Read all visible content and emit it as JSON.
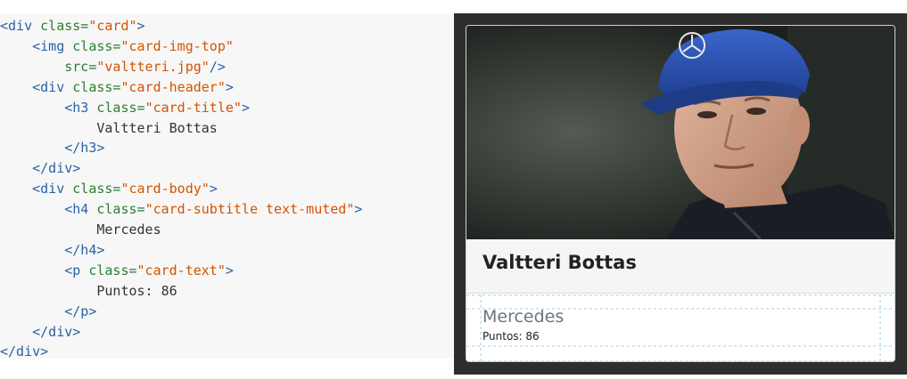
{
  "code": {
    "lines": [
      {
        "parts": [
          {
            "t": "tag",
            "v": "<div "
          },
          {
            "t": "attr",
            "v": "class="
          },
          {
            "t": "val",
            "v": "\"card\""
          },
          {
            "t": "tag",
            "v": ">"
          }
        ]
      },
      {
        "parts": [
          {
            "t": "text",
            "v": "    "
          },
          {
            "t": "tag",
            "v": "<img "
          },
          {
            "t": "attr",
            "v": "class="
          },
          {
            "t": "val",
            "v": "\"card-img-top\""
          }
        ]
      },
      {
        "parts": [
          {
            "t": "text",
            "v": "        "
          },
          {
            "t": "attr",
            "v": "src="
          },
          {
            "t": "val",
            "v": "\"valtteri.jpg\""
          },
          {
            "t": "tag",
            "v": "/>"
          }
        ]
      },
      {
        "parts": [
          {
            "t": "text",
            "v": "    "
          },
          {
            "t": "tag",
            "v": "<div "
          },
          {
            "t": "attr",
            "v": "class="
          },
          {
            "t": "val",
            "v": "\"card-header\""
          },
          {
            "t": "tag",
            "v": ">"
          }
        ]
      },
      {
        "parts": [
          {
            "t": "text",
            "v": "        "
          },
          {
            "t": "tag",
            "v": "<h3 "
          },
          {
            "t": "attr",
            "v": "class="
          },
          {
            "t": "val",
            "v": "\"card-title\""
          },
          {
            "t": "tag",
            "v": ">"
          }
        ]
      },
      {
        "parts": [
          {
            "t": "text",
            "v": "            Valtteri Bottas"
          }
        ]
      },
      {
        "parts": [
          {
            "t": "text",
            "v": "        "
          },
          {
            "t": "tag",
            "v": "</h3>"
          }
        ]
      },
      {
        "parts": [
          {
            "t": "text",
            "v": "    "
          },
          {
            "t": "tag",
            "v": "</div>"
          }
        ]
      },
      {
        "parts": [
          {
            "t": "text",
            "v": "    "
          },
          {
            "t": "tag",
            "v": "<div "
          },
          {
            "t": "attr",
            "v": "class="
          },
          {
            "t": "val",
            "v": "\"card-body\""
          },
          {
            "t": "tag",
            "v": ">"
          }
        ]
      },
      {
        "parts": [
          {
            "t": "text",
            "v": "        "
          },
          {
            "t": "tag",
            "v": "<h4 "
          },
          {
            "t": "attr",
            "v": "class="
          },
          {
            "t": "val",
            "v": "\"card-subtitle text-muted\""
          },
          {
            "t": "tag",
            "v": ">"
          }
        ]
      },
      {
        "parts": [
          {
            "t": "text",
            "v": "            Mercedes"
          }
        ]
      },
      {
        "parts": [
          {
            "t": "text",
            "v": "        "
          },
          {
            "t": "tag",
            "v": "</h4>"
          }
        ]
      },
      {
        "parts": [
          {
            "t": "text",
            "v": "        "
          },
          {
            "t": "tag",
            "v": "<p "
          },
          {
            "t": "attr",
            "v": "class="
          },
          {
            "t": "val",
            "v": "\"card-text\""
          },
          {
            "t": "tag",
            "v": ">"
          }
        ]
      },
      {
        "parts": [
          {
            "t": "text",
            "v": "            Puntos: 86"
          }
        ]
      },
      {
        "parts": [
          {
            "t": "text",
            "v": "        "
          },
          {
            "t": "tag",
            "v": "</p>"
          }
        ]
      },
      {
        "parts": [
          {
            "t": "text",
            "v": "    "
          },
          {
            "t": "tag",
            "v": "</div>"
          }
        ]
      },
      {
        "parts": [
          {
            "t": "tag",
            "v": "</div>"
          }
        ]
      }
    ]
  },
  "card": {
    "title": "Valtteri Bottas",
    "subtitle": "Mercedes",
    "text": "Puntos: 86",
    "image_icon": "driver-portrait-photo"
  },
  "colors": {
    "tag": "#2962a8",
    "attr": "#2e7d32",
    "val": "#d35400",
    "frame": "#2e2e2e",
    "cap": "#2b55b8",
    "guide": "#9fd0e6"
  }
}
